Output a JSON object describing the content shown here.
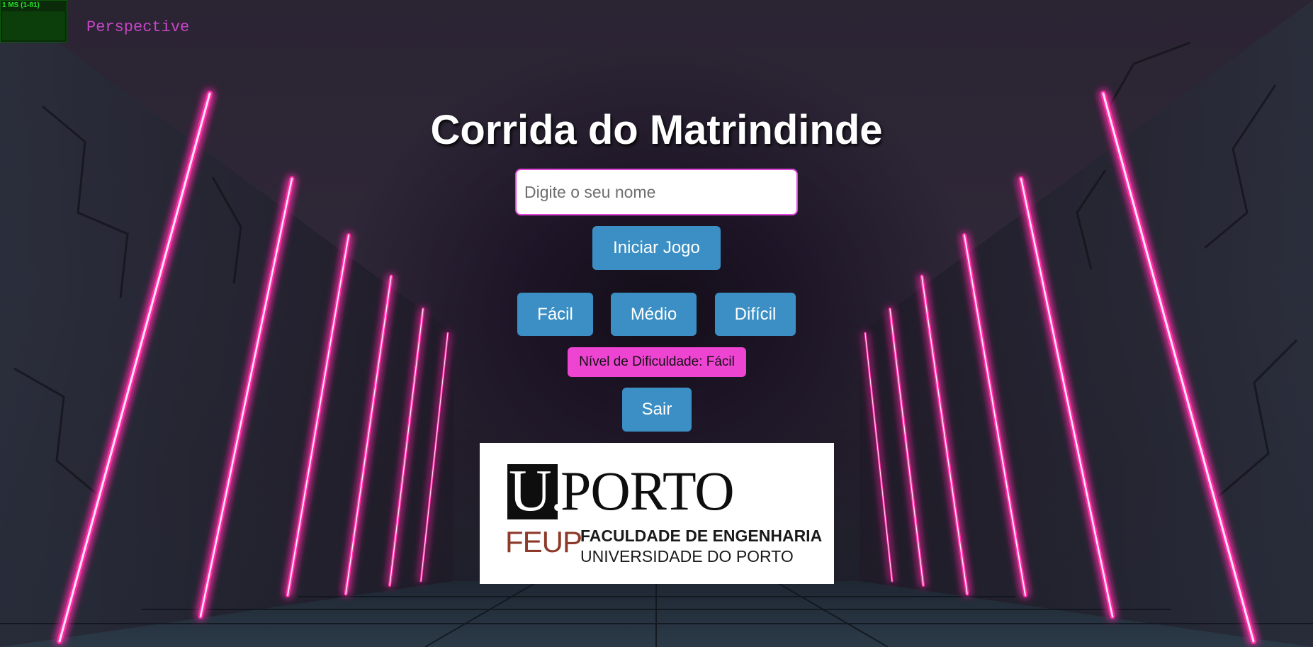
{
  "stats": {
    "text": "1 MS (1-81)"
  },
  "camera": {
    "label": "Perspective"
  },
  "menu": {
    "title": "Corrida do Matrindinde",
    "name_input": {
      "value": "",
      "placeholder": "Digite o seu nome"
    },
    "start_label": "Iniciar Jogo",
    "difficulties": [
      {
        "label": "Fácil"
      },
      {
        "label": "Médio"
      },
      {
        "label": "Difícil"
      }
    ],
    "difficulty_status": "Nível de Dificuldade: Fácil",
    "exit_label": "Sair"
  },
  "logo": {
    "u_text": "U.",
    "porto_text": "PORTO",
    "feup_text": "FEUP",
    "faculty_text": "FACULDADE DE ENGENHARIA",
    "university_text": "UNIVERSIDADE DO PORTO"
  },
  "colors": {
    "button": "#3b8fc4",
    "accent_pink": "#ee44d2",
    "neon": "#ff2fa8"
  }
}
